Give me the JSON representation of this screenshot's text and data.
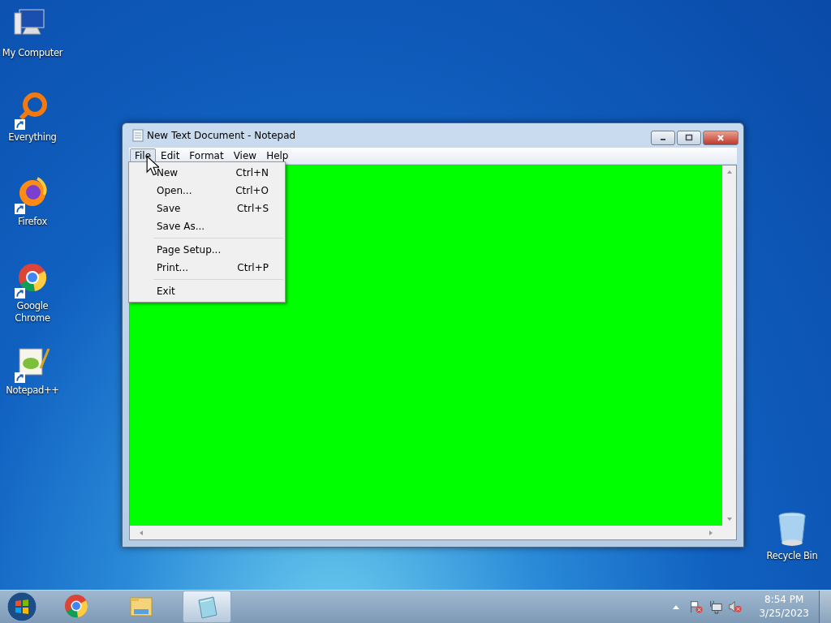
{
  "desktop_icons": [
    {
      "kind": "computer",
      "label": "My Computer",
      "shortcut": false
    },
    {
      "kind": "everything",
      "label": "Everything",
      "shortcut": true
    },
    {
      "kind": "firefox",
      "label": "Firefox",
      "shortcut": true
    },
    {
      "kind": "chrome",
      "label": "Google Chrome",
      "shortcut": true
    },
    {
      "kind": "notepadpp",
      "label": "Notepad++",
      "shortcut": true
    }
  ],
  "recycle_bin": {
    "label": "Recycle Bin"
  },
  "window": {
    "title": "New Text Document - Notepad",
    "menu_bar": [
      {
        "label": "File",
        "selected": true
      },
      {
        "label": "Edit",
        "selected": false
      },
      {
        "label": "Format",
        "selected": false
      },
      {
        "label": "View",
        "selected": false
      },
      {
        "label": "Help",
        "selected": false
      }
    ],
    "file_menu": [
      [
        {
          "label": "New",
          "shortcut": "Ctrl+N"
        },
        {
          "label": "Open...",
          "shortcut": "Ctrl+O"
        },
        {
          "label": "Save",
          "shortcut": "Ctrl+S"
        },
        {
          "label": "Save As..."
        }
      ],
      [
        {
          "label": "Page Setup..."
        },
        {
          "label": "Print...",
          "shortcut": "Ctrl+P"
        }
      ],
      [
        {
          "label": "Exit"
        }
      ]
    ]
  },
  "taskbar": {
    "items": [
      {
        "kind": "chrome",
        "selected": false
      },
      {
        "kind": "explorer",
        "selected": false
      },
      {
        "kind": "notepad",
        "selected": true
      }
    ],
    "clock": {
      "time": "8:54 PM",
      "date": "3/25/2023"
    }
  }
}
